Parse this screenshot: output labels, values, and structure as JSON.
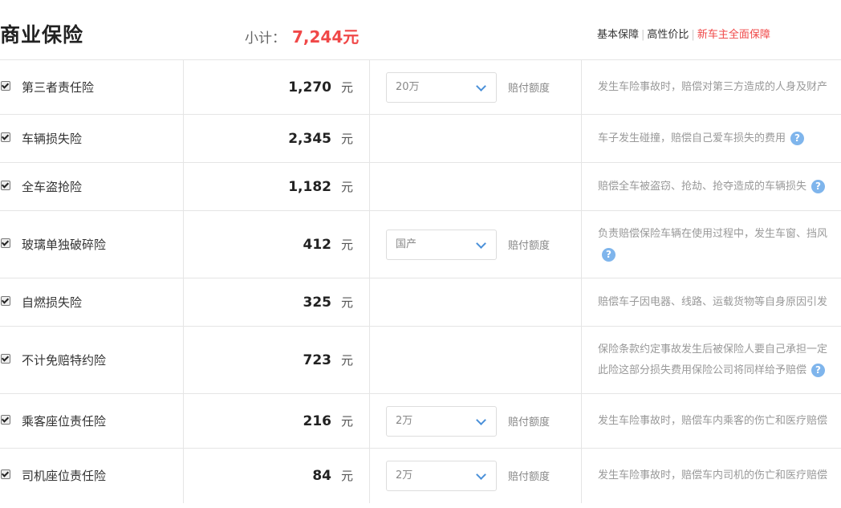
{
  "header": {
    "title": "商业保险",
    "subtotal_label": "小计：",
    "subtotal_value": "7,244元",
    "tabs": [
      "基本保障",
      "高性价比",
      "新车主全面保障"
    ]
  },
  "rows": [
    {
      "name": "第三者责任险",
      "price": "1,270",
      "unit": "元",
      "select": "20万",
      "select_label": "赔付额度",
      "desc": "发生车险事故时，赔偿对第三方造成的人身及财产"
    },
    {
      "name": "车辆损失险",
      "price": "2,345",
      "unit": "元",
      "desc": "车子发生碰撞，赔偿自己爱车损失的费用"
    },
    {
      "name": "全车盗抢险",
      "price": "1,182",
      "unit": "元",
      "desc": "赔偿全车被盗窃、抢劫、抢夺造成的车辆损失"
    },
    {
      "name": "玻璃单独破碎险",
      "price": "412",
      "unit": "元",
      "select": "国产",
      "select_label": "赔付额度",
      "desc": "负责赔偿保险车辆在使用过程中，发生车窗、挡风"
    },
    {
      "name": "自燃损失险",
      "price": "325",
      "unit": "元",
      "desc": "赔偿车子因电器、线路、运载货物等自身原因引发"
    },
    {
      "name": "不计免赔特约险",
      "price": "723",
      "unit": "元",
      "desc": "保险条款约定事故发生后被保险人要自己承担一定",
      "desc2": "此险这部分损失费用保险公司将同样给予赔偿"
    },
    {
      "name": "乘客座位责任险",
      "price": "216",
      "unit": "元",
      "select": "2万",
      "select_label": "赔付额度",
      "desc": "发生车险事故时，赔偿车内乘客的伤亡和医疗赔偿"
    },
    {
      "name": "司机座位责任险",
      "price": "84",
      "unit": "元",
      "select": "2万",
      "select_label": "赔付额度",
      "desc": "发生车险事故时，赔偿车内司机的伤亡和医疗赔偿"
    }
  ],
  "help_icon": "?"
}
